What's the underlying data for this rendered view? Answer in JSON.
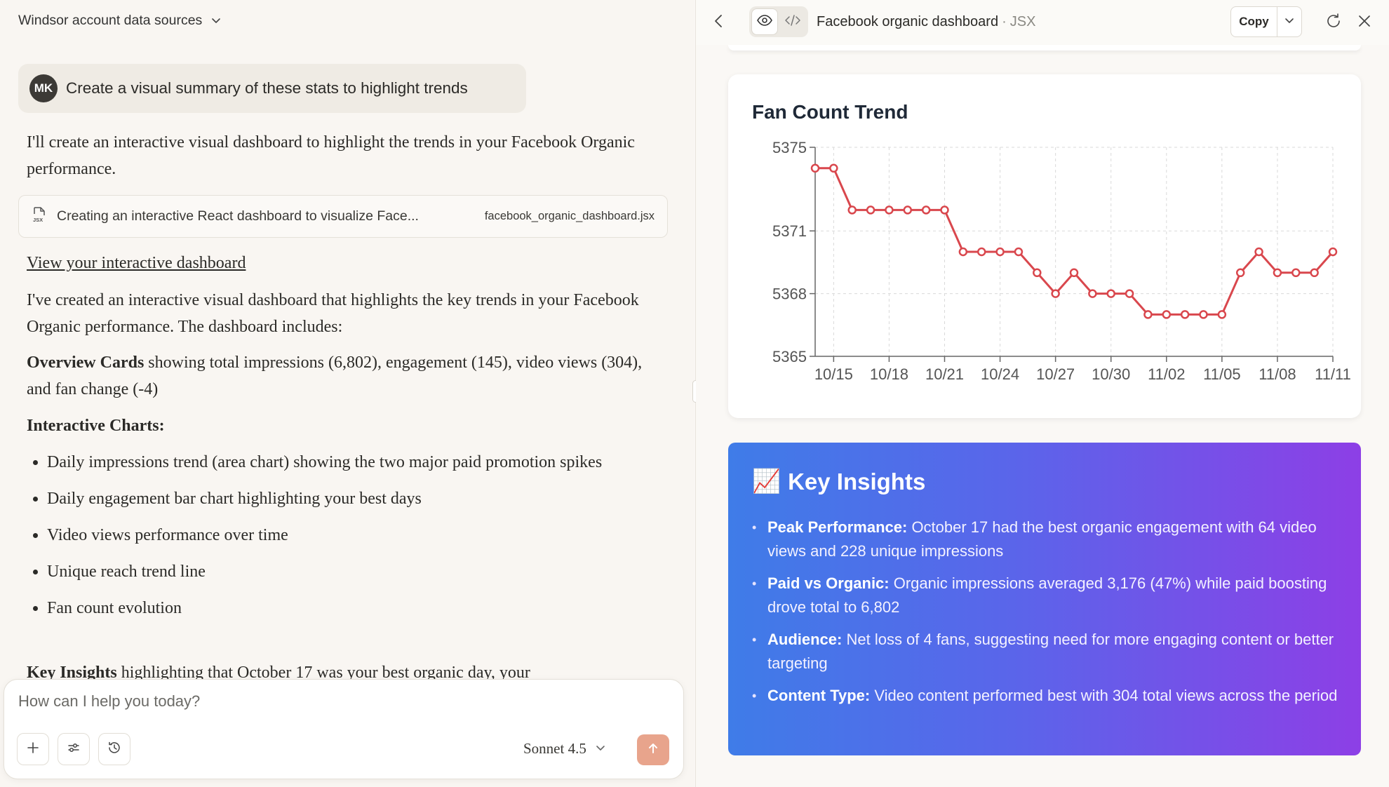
{
  "conversation": {
    "title": "Windsor account data sources",
    "user_initials": "MK",
    "user_message": "Create a visual summary of these stats to highlight trends",
    "reply_intro": "I'll create an interactive visual dashboard to highlight the trends in your Facebook Organic performance.",
    "artifact_description": "Creating an interactive React dashboard to visualize Face...",
    "artifact_file": "facebook_organic_dashboard.jsx",
    "artifact_file_badge": "JSX",
    "view_link": "View your interactive dashboard",
    "reply_body": "I've created an interactive visual dashboard that highlights the key trends in your Facebook Organic performance. The dashboard includes:",
    "overview_bold": "Overview Cards",
    "overview_text": " showing total impressions (6,802), engagement (145), video views (304), and fan change (-4)",
    "charts_heading": "Interactive Charts:",
    "chart_bullets": [
      "Daily impressions trend (area chart) showing the two major paid promotion spikes",
      "Daily engagement bar chart highlighting your best days",
      "Video views performance over time",
      "Unique reach trend line",
      "Fan count evolution"
    ],
    "key_bold": "Key Insights",
    "key_text": " highlighting that October 17 was your best organic day, your"
  },
  "composer": {
    "placeholder": "How can I help you today?",
    "model": "Sonnet 4.5"
  },
  "artifact": {
    "title": "Facebook organic dashboard",
    "separator": "·",
    "kind": "JSX",
    "copy_label": "Copy"
  },
  "chart_data": {
    "type": "line",
    "title": "Fan Count Trend",
    "x": [
      "10/14",
      "10/15",
      "10/16",
      "10/17",
      "10/18",
      "10/19",
      "10/20",
      "10/21",
      "10/22",
      "10/23",
      "10/24",
      "10/25",
      "10/26",
      "10/27",
      "10/28",
      "10/29",
      "10/30",
      "10/31",
      "11/01",
      "11/02",
      "11/03",
      "11/04",
      "11/05",
      "11/06",
      "11/07",
      "11/08",
      "11/09",
      "11/10",
      "11/11"
    ],
    "values": [
      5374,
      5374,
      5372,
      5372,
      5372,
      5372,
      5372,
      5372,
      5370,
      5370,
      5370,
      5370,
      5369,
      5368,
      5369,
      5368,
      5368,
      5368,
      5367,
      5367,
      5367,
      5367,
      5367,
      5369,
      5370,
      5369,
      5369,
      5369,
      5370
    ],
    "x_tick_labels": [
      "10/15",
      "10/18",
      "10/21",
      "10/24",
      "10/27",
      "10/30",
      "11/02",
      "11/05",
      "11/08",
      "11/11"
    ],
    "y_ticks": [
      5365,
      5368,
      5371,
      5375
    ],
    "ylim": [
      5365,
      5375
    ],
    "grid": true,
    "line_color": "#d9474d"
  },
  "insights": {
    "icon": "📈",
    "title": "Key Insights",
    "items": [
      {
        "label": "Peak Performance:",
        "text": " October 17 had the best organic engagement with 64 video views and 228 unique impressions"
      },
      {
        "label": "Paid vs Organic:",
        "text": " Organic impressions averaged 3,176 (47%) while paid boosting drove total to 6,802"
      },
      {
        "label": "Audience:",
        "text": " Net loss of 4 fans, suggesting need for more engaging content or better targeting"
      },
      {
        "label": "Content Type:",
        "text": " Video content performed best with 304 total views across the period"
      }
    ]
  }
}
